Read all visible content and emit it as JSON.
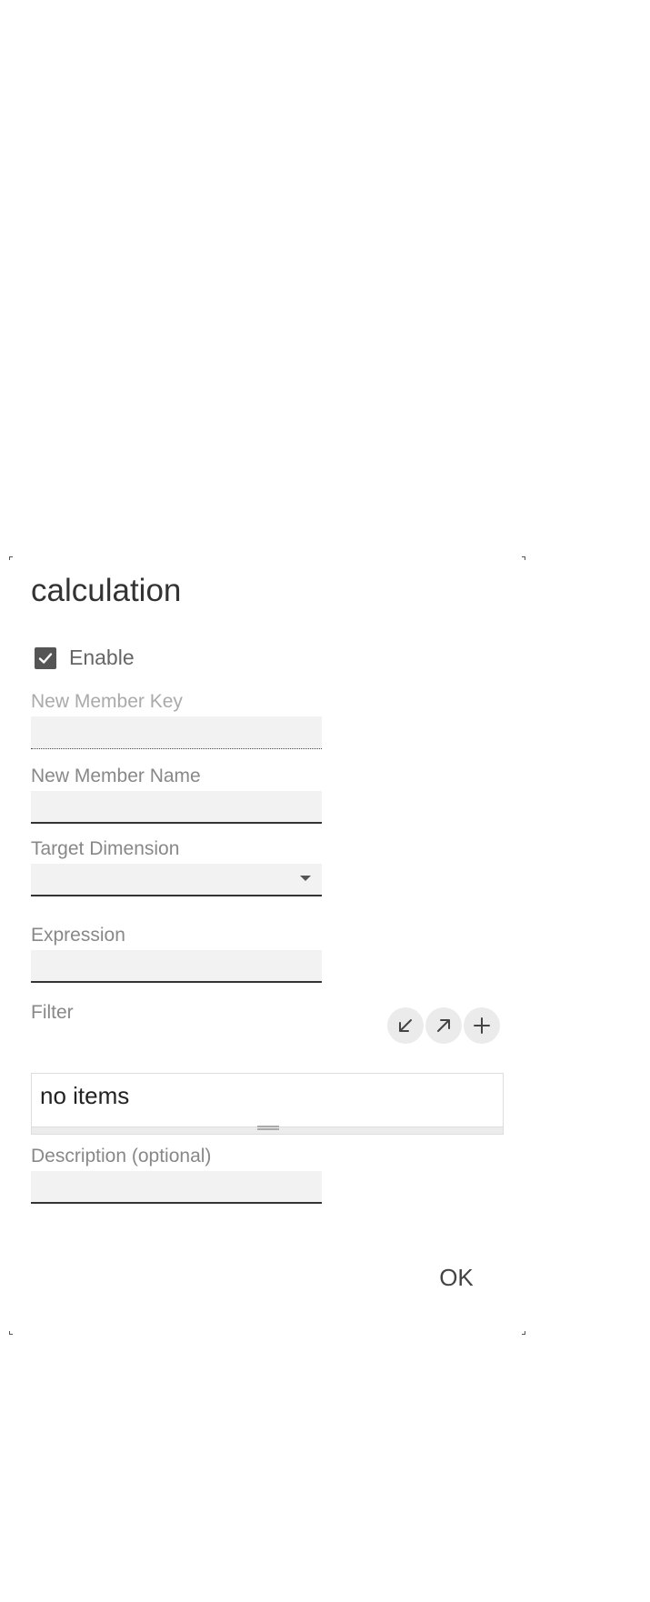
{
  "dialog": {
    "title": "calculation",
    "enable": {
      "label": "Enable",
      "checked": true
    },
    "fields": {
      "new_member_key": {
        "label": "New Member Key",
        "value": ""
      },
      "new_member_name": {
        "label": "New Member Name",
        "value": ""
      },
      "target_dimension": {
        "label": "Target Dimension",
        "selected": ""
      },
      "expression": {
        "label": "Expression",
        "value": ""
      },
      "filter": {
        "label": "Filter",
        "empty_text": "no items",
        "actions": [
          "collapse-icon",
          "expand-icon",
          "add-icon"
        ]
      },
      "description": {
        "label": "Description (optional)",
        "value": ""
      }
    },
    "ok_label": "OK"
  }
}
